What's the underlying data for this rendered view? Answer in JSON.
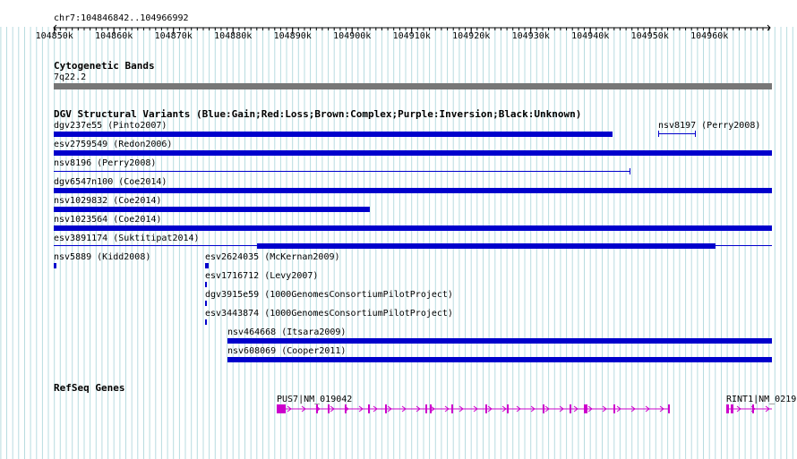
{
  "region": {
    "label": "chr7:104846842..104966992",
    "ticks": [
      "104850k",
      "104860k",
      "104870k",
      "104880k",
      "104890k",
      "104900k",
      "104910k",
      "104920k",
      "104930k",
      "104940k",
      "104950k",
      "104960k"
    ]
  },
  "cytoband": {
    "title": "Cytogenetic Bands",
    "band": "7q22.2"
  },
  "dgv": {
    "title": "DGV Structural Variants (Blue:Gain;Red:Loss;Brown:Complex;Purple:Inversion;Black:Unknown)",
    "variants": [
      {
        "label": "dgv237e55 (Pinto2007)"
      },
      {
        "label": "nsv8197 (Perry2008)"
      },
      {
        "label": "esv2759549 (Redon2006)"
      },
      {
        "label": "nsv8196 (Perry2008)"
      },
      {
        "label": "dgv6547n100 (Coe2014)"
      },
      {
        "label": "nsv1029832 (Coe2014)"
      },
      {
        "label": "nsv1023564 (Coe2014)"
      },
      {
        "label": "esv3891174 (Suktitipat2014)"
      },
      {
        "label": "nsv5889 (Kidd2008)"
      },
      {
        "label": "esv2624035 (McKernan2009)"
      },
      {
        "label": "esv1716712 (Levy2007)"
      },
      {
        "label": "dgv3915e59 (1000GenomesConsortiumPilotProject)"
      },
      {
        "label": "esv3443874 (1000GenomesConsortiumPilotProject)"
      },
      {
        "label": "nsv464668 (Itsara2009)"
      },
      {
        "label": "nsv608069 (Cooper2011)"
      }
    ]
  },
  "refseq": {
    "title": "RefSeq Genes",
    "genes": [
      {
        "label": "PUS7|NM_019042"
      },
      {
        "label": "RINT1|NM_0219"
      }
    ]
  },
  "colors": {
    "grid": "#b8dce0",
    "variant": "#0000cc",
    "gene": "#cc00cc",
    "cytoband": "#777777"
  }
}
